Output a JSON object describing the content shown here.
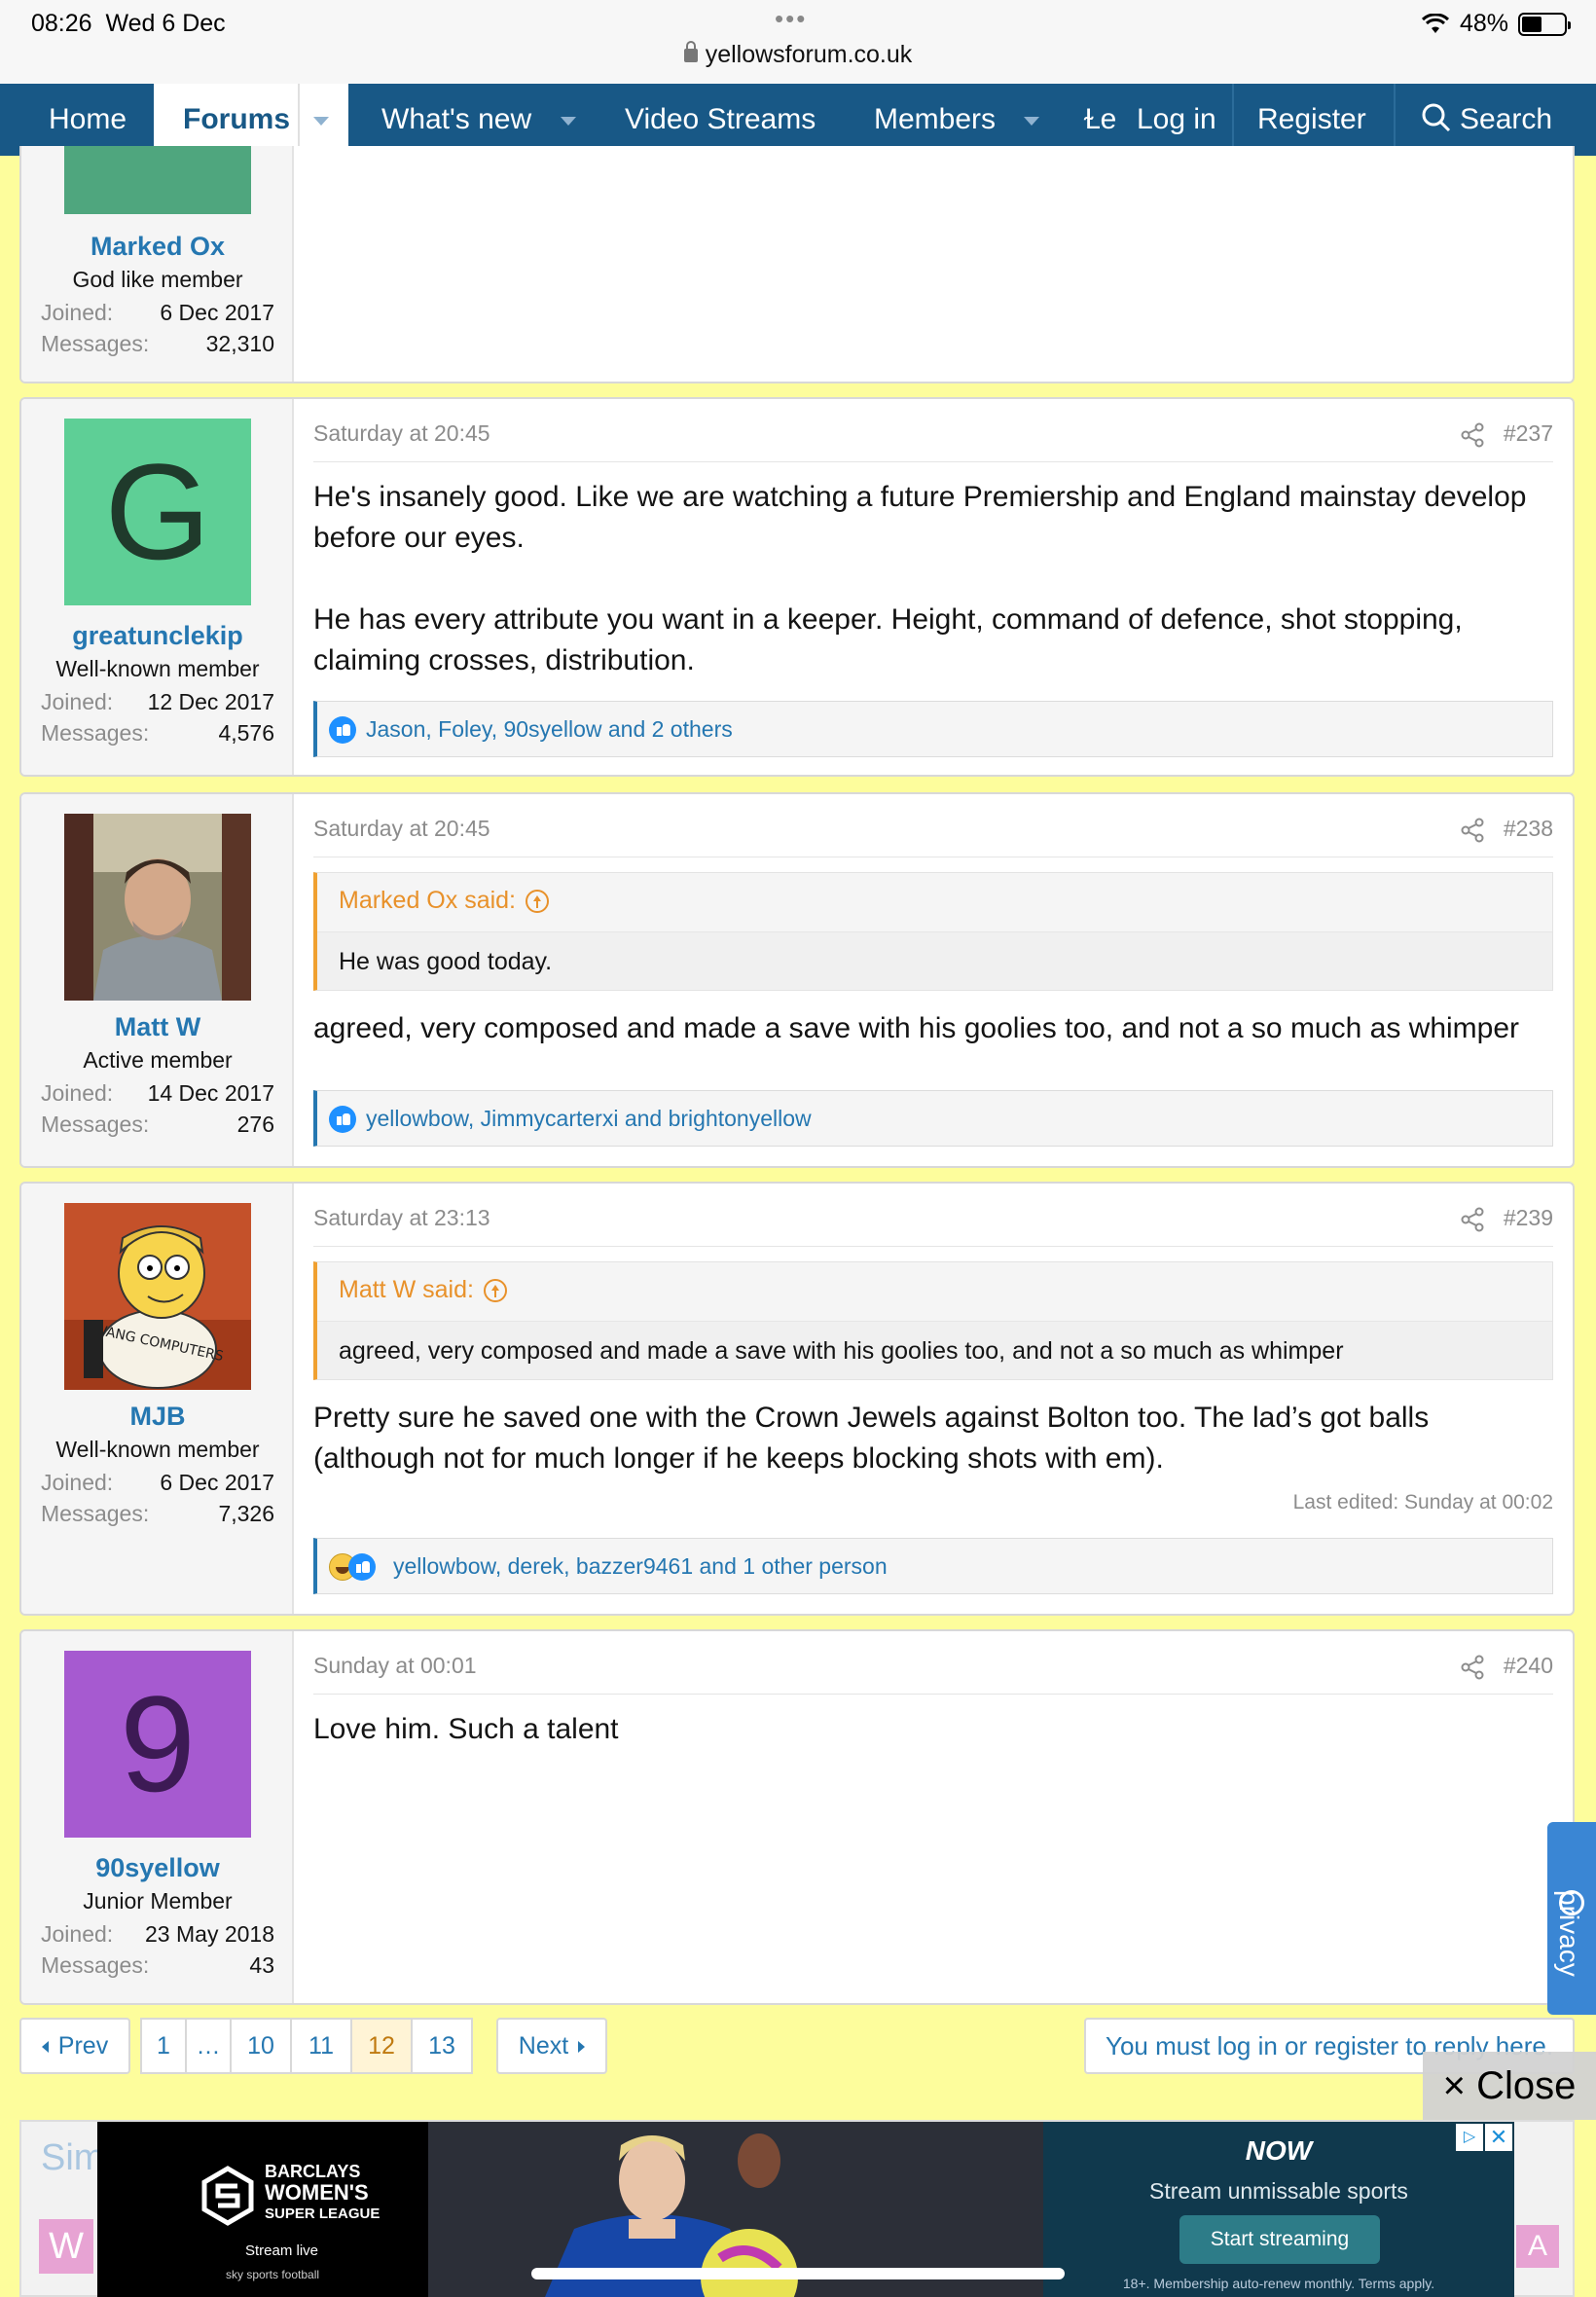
{
  "status_bar": {
    "time": "08:26",
    "date": "Wed 6 Dec",
    "dots": "•••",
    "url": "yellowsforum.co.uk",
    "battery": "48%",
    "battery_level": 0.48
  },
  "nav": {
    "home": "Home",
    "forums": "Forums",
    "whats_new": "What's new",
    "video_streams": "Video Streams",
    "members": "Members",
    "overflow": "Ɫe",
    "login": "Log in",
    "register": "Register",
    "search": "Search"
  },
  "top_post": {
    "username": "Marked Ox",
    "title": "God like member",
    "joined_label": "Joined:",
    "joined": "6 Dec 2017",
    "messages_label": "Messages:",
    "messages": "32,310",
    "avatar_color": "#4fa67e"
  },
  "posts": [
    {
      "avatar_letter": "G",
      "avatar_color": "#5ecf96",
      "avatar_text_color": "#1f3a2b",
      "username": "greatunclekip",
      "title": "Well-known member",
      "joined_label": "Joined:",
      "joined": "12 Dec 2017",
      "messages_label": "Messages:",
      "messages": "4,576",
      "date": "Saturday at 20:45",
      "number": "#237",
      "body": [
        "He's insanely good. Like we are watching a future Premiership and England mainstay develop before our eyes.",
        "He has every attribute you want in a keeper. Height, command of defence, shot stopping, claiming crosses, distribution."
      ],
      "reactions": "Jason, Foley, 90syellow and 2 others"
    },
    {
      "username": "Matt W",
      "title": "Active member",
      "joined_label": "Joined:",
      "joined": "14 Dec 2017",
      "messages_label": "Messages:",
      "messages": "276",
      "date": "Saturday at 20:45",
      "number": "#238",
      "quote_author": "Marked Ox said:",
      "quote_text": "He was good today.",
      "body": [
        "agreed, very composed and made a save with his goolies too, and not a so much as whimper"
      ],
      "reactions": "yellowbow, Jimmycarterxi and brightonyellow"
    },
    {
      "username": "MJB",
      "title": "Well-known member",
      "joined_label": "Joined:",
      "joined": "6 Dec 2017",
      "messages_label": "Messages:",
      "messages": "7,326",
      "avatar_caption": "WANG COMPUTERS",
      "date": "Saturday at 23:13",
      "number": "#239",
      "quote_author": "Matt W said:",
      "quote_text": "agreed, very composed and made a save with his goolies too, and not a so much as whimper",
      "body": [
        "Pretty sure he saved one with the Crown Jewels against Bolton too. The lad’s got balls (although not for much longer if he keeps blocking shots with em)."
      ],
      "edited": "Last edited: Sunday at 00:02",
      "reactions": "yellowbow, derek, bazzer9461 and 1 other person"
    },
    {
      "avatar_letter": "9",
      "avatar_color": "#a65ad0",
      "avatar_text_color": "#3d1a55",
      "username": "90syellow",
      "title": "Junior Member",
      "joined_label": "Joined:",
      "joined": "23 May 2018",
      "messages_label": "Messages:",
      "messages": "43",
      "date": "Sunday at 00:01",
      "number": "#240",
      "body": [
        "Love him. Such a talent"
      ]
    }
  ],
  "pagination": {
    "prev": "Prev",
    "pages": [
      "1",
      "…",
      "10",
      "11",
      "12",
      "13"
    ],
    "current": "12",
    "next": "Next"
  },
  "login_notice": "You must log in or register to reply here.",
  "close_button": "× Close",
  "privacy_tab": "privacy",
  "similar": {
    "title": "Sim",
    "letter_left": "W",
    "letter_right": "A"
  },
  "ad": {
    "brand_line1": "BARCLAYS",
    "brand_line2": "WOMEN'S",
    "brand_line3": "SUPER LEAGUE",
    "stream_live": "Stream live",
    "sky_sports": "sky sports football",
    "now_logo": "NOW",
    "tagline": "Stream unmissable sports",
    "cta": "Start streaming",
    "fineprint": "18+. Membership auto-renew monthly. Terms apply."
  }
}
